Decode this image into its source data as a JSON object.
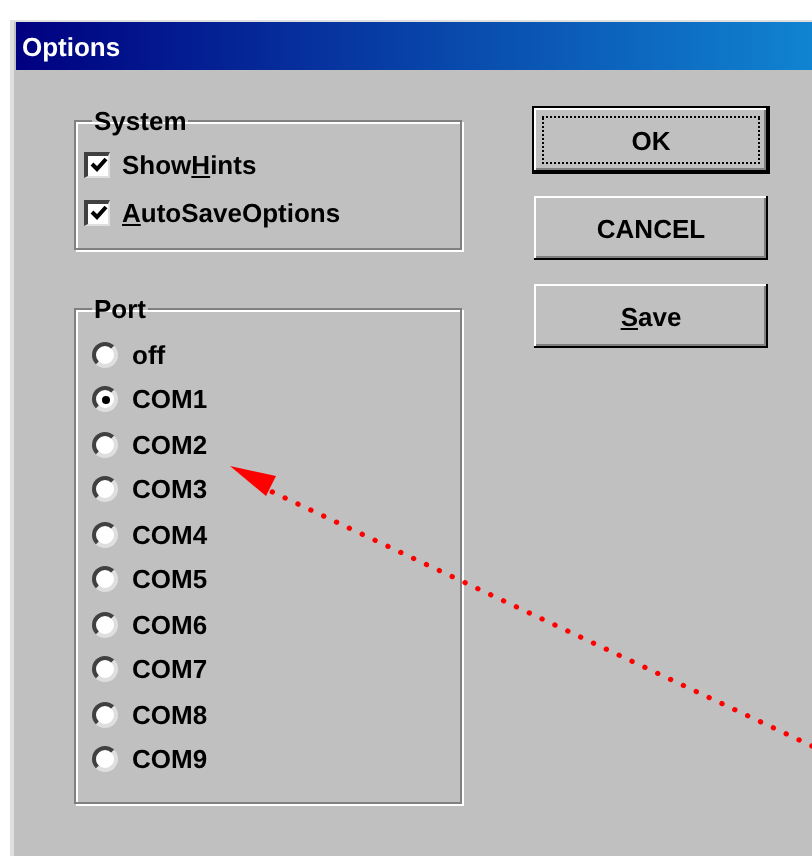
{
  "window": {
    "title": "Options"
  },
  "system": {
    "title": "System",
    "options": [
      {
        "before": "Show",
        "mnemonic": "H",
        "after": "ints",
        "checked": true
      },
      {
        "mnemonic": "A",
        "after": "utoSaveOptions",
        "checked": true
      }
    ]
  },
  "port": {
    "title": "Port",
    "options": [
      {
        "label": "off",
        "selected": false
      },
      {
        "label": "COM1",
        "selected": true
      },
      {
        "label": "COM2",
        "selected": false
      },
      {
        "label": "COM3",
        "selected": false
      },
      {
        "label": "COM4",
        "selected": false
      },
      {
        "label": "COM5",
        "selected": false
      },
      {
        "label": "COM6",
        "selected": false
      },
      {
        "label": "COM7",
        "selected": false
      },
      {
        "label": "COM8",
        "selected": false
      },
      {
        "label": "COM9",
        "selected": false
      }
    ]
  },
  "buttons": [
    {
      "label": "OK",
      "default": true
    },
    {
      "label": "CANCEL",
      "default": false
    },
    {
      "mnemonic": "S",
      "after": "ave",
      "default": false
    }
  ]
}
